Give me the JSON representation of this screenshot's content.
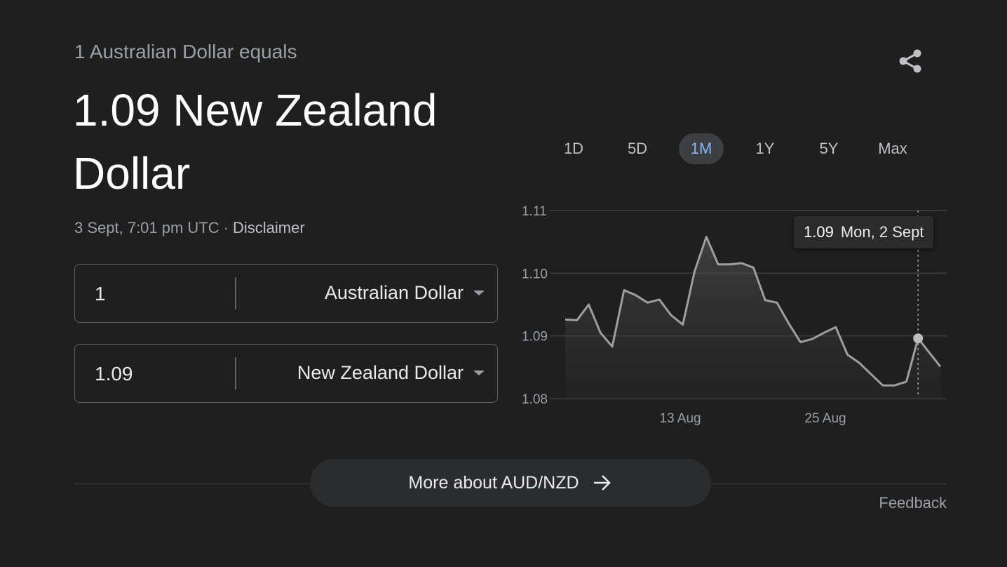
{
  "header": {
    "subtitle": "1 Australian Dollar equals",
    "headline": "1.09 New Zealand Dollar",
    "timestamp": "3 Sept, 7:01 pm UTC",
    "separator": "·",
    "disclaimer": "Disclaimer"
  },
  "converter": {
    "from": {
      "amount": "1",
      "currency": "Australian Dollar"
    },
    "to": {
      "amount": "1.09",
      "currency": "New Zealand Dollar"
    }
  },
  "range_tabs": {
    "items": [
      "1D",
      "5D",
      "1M",
      "1Y",
      "5Y",
      "Max"
    ],
    "active": "1M"
  },
  "tooltip": {
    "value": "1.09",
    "date": "Mon, 2 Sept"
  },
  "footer": {
    "more_label": "More about AUD/NZD",
    "feedback": "Feedback"
  },
  "colors": {
    "background": "#1f1f1f",
    "active_tab_text": "#8ab4f8",
    "line": "#9e9e9e"
  },
  "chart_data": {
    "type": "area",
    "ylim": [
      1.08,
      1.11
    ],
    "yticks": [
      "1.11",
      "1.10",
      "1.09",
      "1.08"
    ],
    "xticks": [
      "13 Aug",
      "25 Aug"
    ],
    "grid": true,
    "series": [
      {
        "values": [
          1.0926,
          1.0925,
          1.095,
          1.0905,
          1.0883,
          1.0973,
          1.0965,
          1.0953,
          1.0958,
          1.0933,
          1.0918,
          1.1003,
          1.1058,
          1.1014,
          1.1014,
          1.1016,
          1.1009,
          1.0957,
          1.0953,
          1.092,
          1.089,
          1.0895,
          1.0905,
          1.0914,
          1.087,
          1.0857,
          1.0839,
          1.0821,
          1.0821,
          1.0827,
          1.0896,
          1.0851
        ]
      }
    ],
    "highlight": {
      "index": 30,
      "value": 1.09,
      "label": "Mon, 2 Sept"
    }
  }
}
